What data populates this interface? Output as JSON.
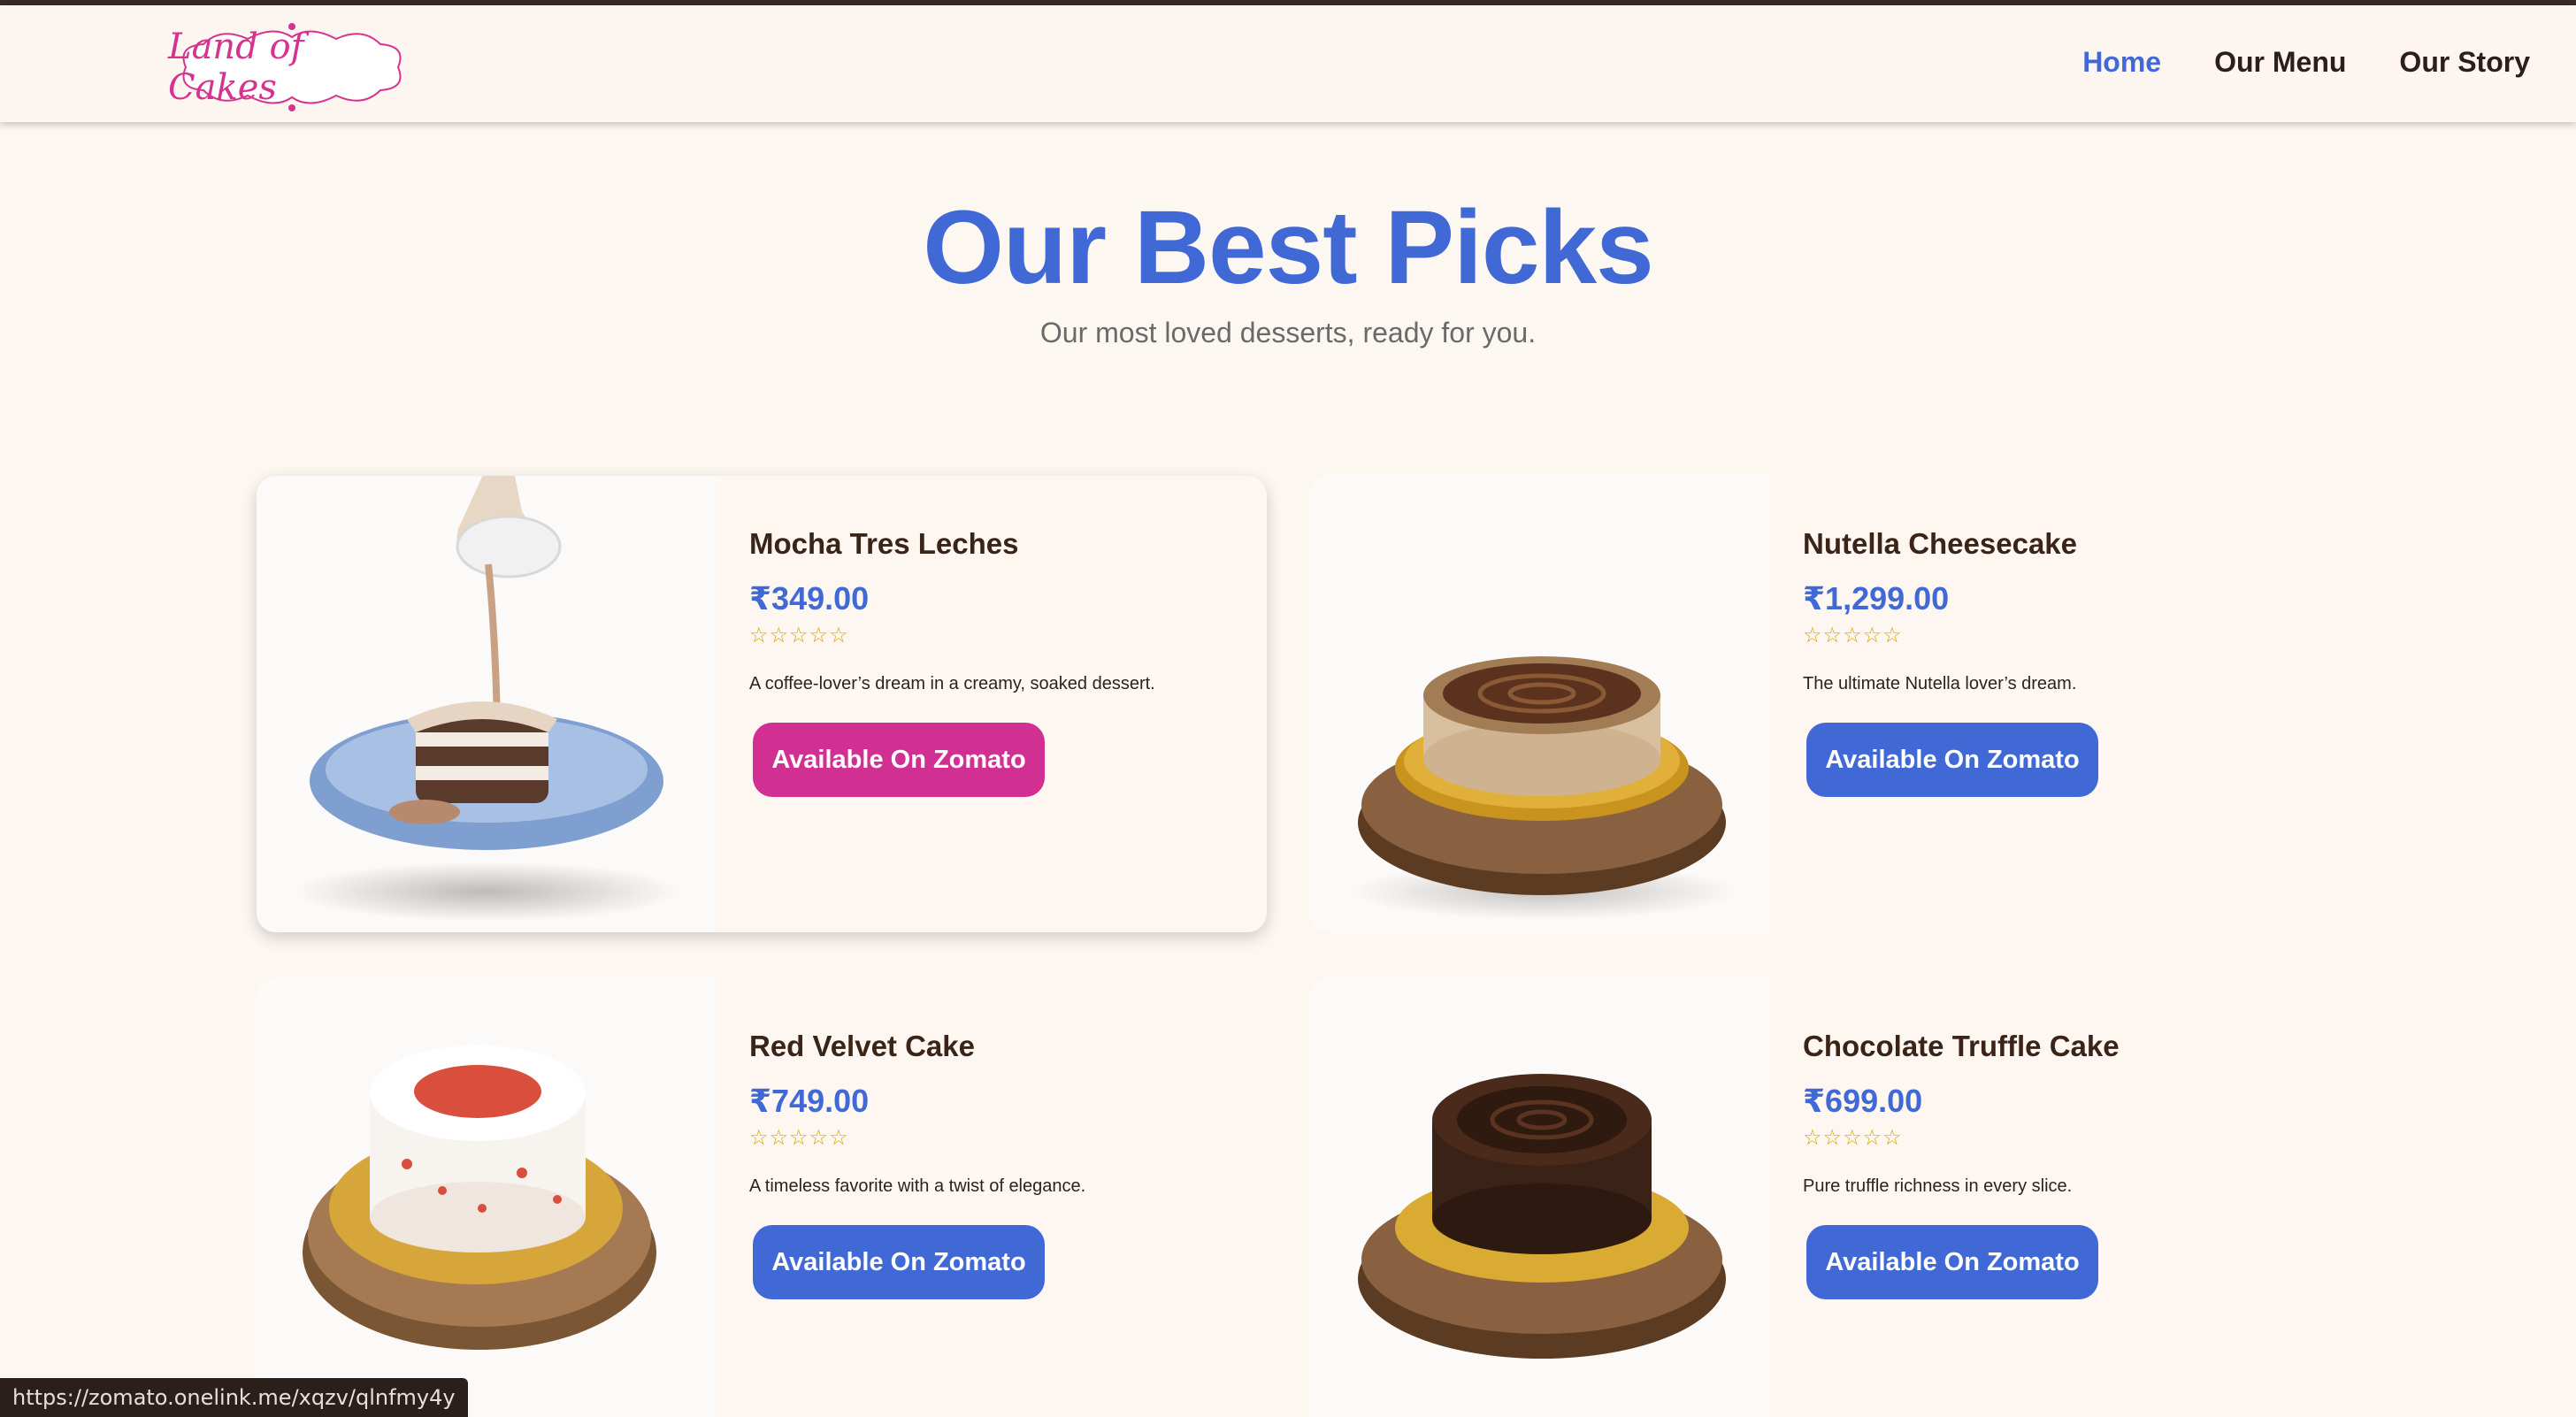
{
  "header": {
    "logo_text": "Land of Cakes",
    "nav": [
      "Home",
      "Our Menu",
      "Our Story"
    ],
    "active": "Home"
  },
  "hero": {
    "title": "Our Best Picks",
    "subtitle": "Our most loved desserts, ready for you."
  },
  "products": [
    {
      "name": "Mocha Tres Leches",
      "price": "₹349.00",
      "rating": "☆☆☆☆☆",
      "description": "A coffee-lover’s dream in a creamy, soaked dessert.",
      "button": "Available On Zomato",
      "button_color": "#d22f93"
    },
    {
      "name": "Nutella Cheesecake",
      "price": "₹1,299.00",
      "rating": "☆☆☆☆☆",
      "description": "The ultimate Nutella lover’s dream.",
      "button": "Available On Zomato",
      "button_color": "#4169d6"
    },
    {
      "name": "Red Velvet Cake",
      "price": "₹749.00",
      "rating": "☆☆☆☆☆",
      "description": "A timeless favorite with a twist of elegance.",
      "button": "Available On Zomato",
      "button_color": "#4169d6"
    },
    {
      "name": "Chocolate Truffle Cake",
      "price": "₹699.00",
      "rating": "☆☆☆☆☆",
      "description": "Pure truffle richness in every slice.",
      "button": "Available On Zomato",
      "button_color": "#4169d6"
    }
  ],
  "status_url": "https://zomato.onelink.me/xqzv/qlnfmy4y",
  "colors": {
    "accent": "#4169d6",
    "brand_pink": "#d22f93",
    "background": "#fdf7f2",
    "rating_star": "#e0a400"
  }
}
